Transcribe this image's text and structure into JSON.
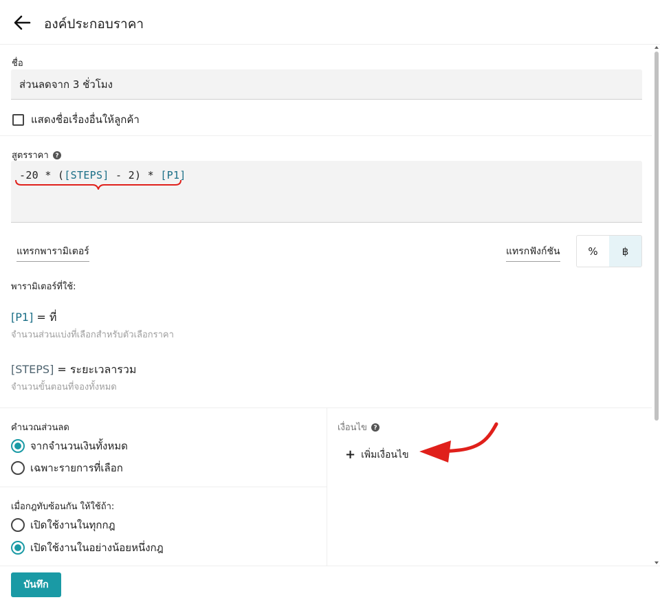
{
  "header": {
    "title": "องค์ประกอบราคา"
  },
  "name_field": {
    "label": "ชื่อ",
    "value": "ส่วนลดจาก 3 ชั่วโมง"
  },
  "show_other_title": {
    "label": "แสดงชื่อเรื่องอื่นให้ลูกค้า",
    "checked": false
  },
  "formula": {
    "label": "สูตรราคา",
    "parts": [
      "-20 * (",
      "[STEPS]",
      " - 2) * ",
      "[P1]"
    ]
  },
  "insert_param": {
    "label": "แทรกพารามิเตอร์"
  },
  "insert_function": {
    "label": "แทรกฟังก์ชัน"
  },
  "unit_toggle": {
    "percent": "%",
    "baht": "฿",
    "selected": "baht"
  },
  "params": {
    "heading": "พารามิเตอร์ที่ใช้:",
    "items": [
      {
        "token": "[P1]",
        "name": " = ที่",
        "desc": "จำนวนส่วนแบ่งที่เลือกสำหรับตัวเลือกราคา"
      },
      {
        "token": "[STEPS]",
        "name": " = ระยะเวลารวม",
        "desc": "จำนวนขั้นตอนที่จองทั้งหมด"
      }
    ]
  },
  "discount_calc": {
    "heading": "คำนวณส่วนลด",
    "options": [
      {
        "label": "จากจำนวนเงินทั้งหมด",
        "checked": true
      },
      {
        "label": "เฉพาะรายการที่เลือก",
        "checked": false
      }
    ]
  },
  "overlap_rule": {
    "heading": "เมื่อกฎทับซ้อนกัน ให้ใช้ถ้า:",
    "options": [
      {
        "label": "เปิดใช้งานในทุกกฎ",
        "checked": false
      },
      {
        "label": "เปิดใช้งานในอย่างน้อยหนึ่งกฎ",
        "checked": true
      }
    ]
  },
  "conditions": {
    "label": "เงื่อนไข",
    "add_label": "เพิ่มเงื่อนไข"
  },
  "footer": {
    "save_label": "บันทึก"
  },
  "colors": {
    "accent": "#1a9aa5",
    "token": "#1a6e86",
    "annotation": "#e0201b"
  },
  "icons": {
    "back": "arrow-left-icon",
    "help": "question-circle-icon",
    "plus": "plus-icon"
  }
}
